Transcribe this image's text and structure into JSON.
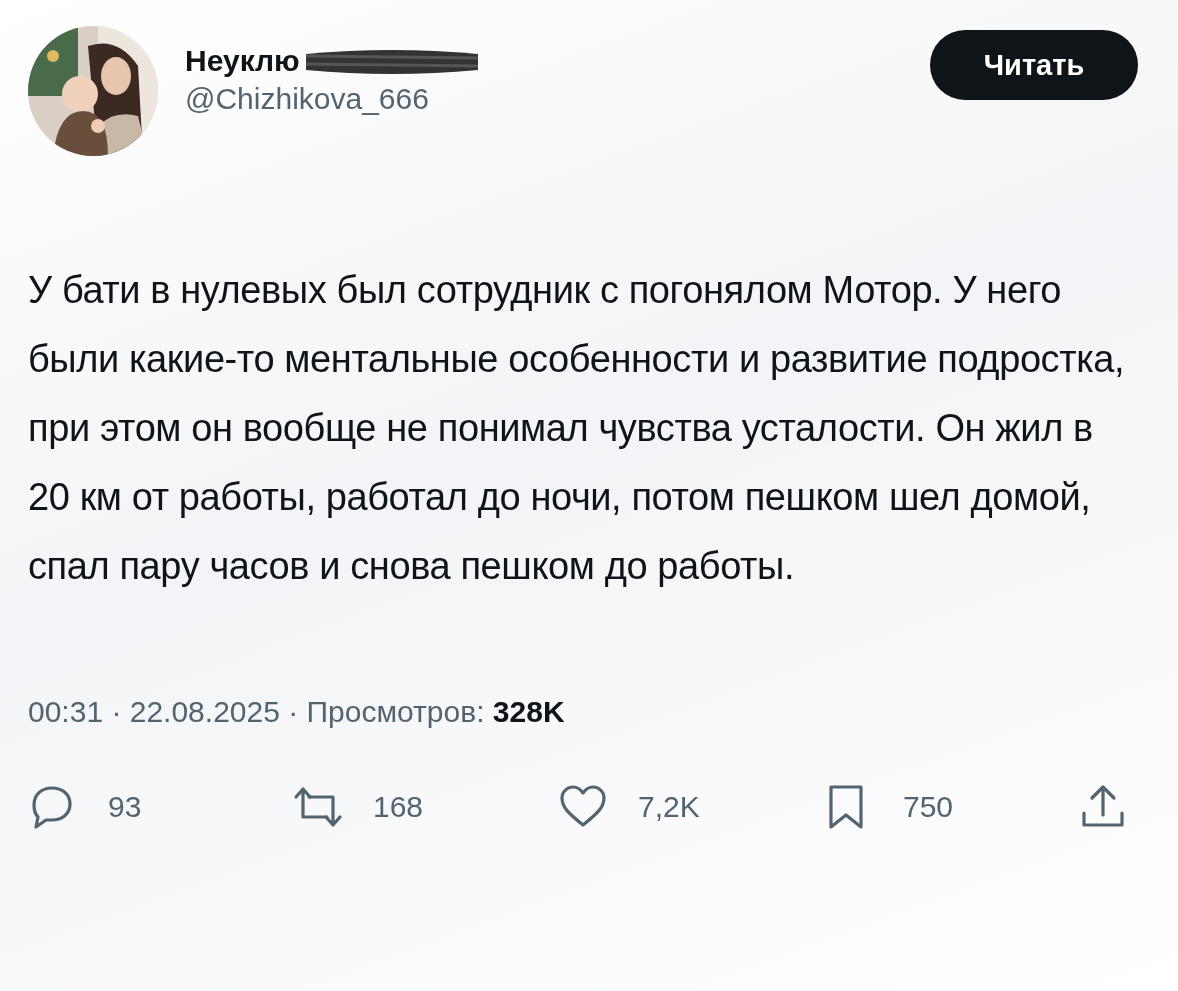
{
  "author": {
    "name": "Неуклю",
    "handle": "@Chizhikova_666"
  },
  "follow_button": "Читать",
  "text": "У бати в нулевых был сотрудник с погонялом Мотор. У него были какие-то ментальные особенности и развитие подростка, при этом он вообще не понимал чувства усталости. Он жил в 20 км от работы, работал до ночи, потом пешком шел домой, спал пару часов и снова пешком до работы.",
  "meta": "00:31 · 22.08.2025 · Просмотров: **328K**",
  "actions": [
    {
      "kind": "reply",
      "count": "93"
    },
    {
      "kind": "repost",
      "count": "168"
    },
    {
      "kind": "like",
      "count": "7,2K"
    },
    {
      "kind": "bookmark",
      "count": "750"
    },
    {
      "kind": "share"
    }
  ]
}
